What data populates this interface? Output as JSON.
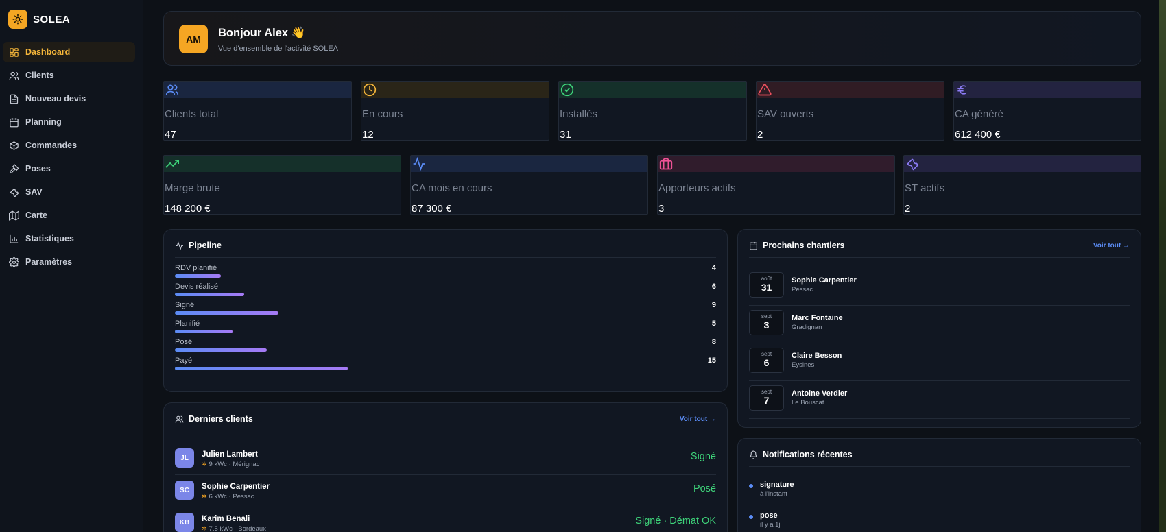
{
  "sidebar": {
    "brand": "SOLEA",
    "items": [
      {
        "label": "Dashboard",
        "icon": "dashboard-icon",
        "active": true
      },
      {
        "label": "Clients",
        "icon": "users-icon"
      },
      {
        "label": "Nouveau devis",
        "icon": "document-icon"
      },
      {
        "label": "Planning",
        "icon": "calendar-icon"
      },
      {
        "label": "Commandes",
        "icon": "package-icon"
      },
      {
        "label": "Poses",
        "icon": "hammer-icon"
      },
      {
        "label": "SAV",
        "icon": "wrench-icon"
      },
      {
        "label": "Carte",
        "icon": "map-icon"
      },
      {
        "label": "Statistiques",
        "icon": "chart-icon"
      },
      {
        "label": "Paramètres",
        "icon": "gear-icon"
      }
    ]
  },
  "welcome": {
    "initials": "AM",
    "title": "Bonjour Alex 👋",
    "subtitle": "Vue d'ensemble de l'activité SOLEA"
  },
  "stats_row1": [
    {
      "label": "Clients total",
      "value": "47",
      "icon": "users-icon",
      "color": "#5b8cf5"
    },
    {
      "label": "En cours",
      "value": "12",
      "icon": "clock-icon",
      "color": "#f5b63a"
    },
    {
      "label": "Installés",
      "value": "31",
      "icon": "check-circle-icon",
      "color": "#3ed37a"
    },
    {
      "label": "SAV ouverts",
      "value": "2",
      "icon": "warning-icon",
      "color": "#f0525f"
    },
    {
      "label": "CA généré",
      "value": "612 400 €",
      "icon": "euro-icon",
      "color": "#8c7cf5"
    }
  ],
  "stats_row2": [
    {
      "label": "Marge brute",
      "value": "148 200 €",
      "icon": "trending-up-icon",
      "color": "#3ed37a"
    },
    {
      "label": "CA mois en cours",
      "value": "87 300 €",
      "icon": "activity-icon",
      "color": "#5b8cf5"
    },
    {
      "label": "Apporteurs actifs",
      "value": "3",
      "icon": "briefcase-icon",
      "color": "#f05296"
    },
    {
      "label": "ST actifs",
      "value": "2",
      "icon": "wrench-icon",
      "color": "#8c7cf5"
    }
  ],
  "pipeline": {
    "title": "Pipeline",
    "max": 15,
    "stages": [
      {
        "label": "RDV planifié",
        "count": 4
      },
      {
        "label": "Devis réalisé",
        "count": 6
      },
      {
        "label": "Signé",
        "count": 9
      },
      {
        "label": "Planifié",
        "count": 5
      },
      {
        "label": "Posé",
        "count": 8
      },
      {
        "label": "Payé",
        "count": 15
      }
    ]
  },
  "chantiers": {
    "title": "Prochains chantiers",
    "link": "Voir tout →",
    "items": [
      {
        "month": "août",
        "day": "31",
        "name": "Sophie Carpentier",
        "city": "Pessac"
      },
      {
        "month": "sept",
        "day": "3",
        "name": "Marc Fontaine",
        "city": "Gradignan"
      },
      {
        "month": "sept",
        "day": "6",
        "name": "Claire Besson",
        "city": "Eysines"
      },
      {
        "month": "sept",
        "day": "7",
        "name": "Antoine Verdier",
        "city": "Le Bouscat"
      }
    ]
  },
  "clients": {
    "title": "Derniers clients",
    "link": "Voir tout →",
    "items": [
      {
        "initials": "JL",
        "name": "Julien Lambert",
        "meta": "9 kWc · Mérignac",
        "status": "Signé"
      },
      {
        "initials": "SC",
        "name": "Sophie Carpentier",
        "meta": "6 kWc · Pessac",
        "status": "Posé"
      },
      {
        "initials": "KB",
        "name": "Karim Benali",
        "meta": "7.5 kWc · Bordeaux",
        "status": "Signé · Démat OK"
      }
    ]
  },
  "notifications": {
    "title": "Notifications récentes",
    "items": [
      {
        "type": "signature",
        "time": "à l'instant"
      },
      {
        "type": "pose",
        "time": "il y a 1j"
      }
    ]
  }
}
